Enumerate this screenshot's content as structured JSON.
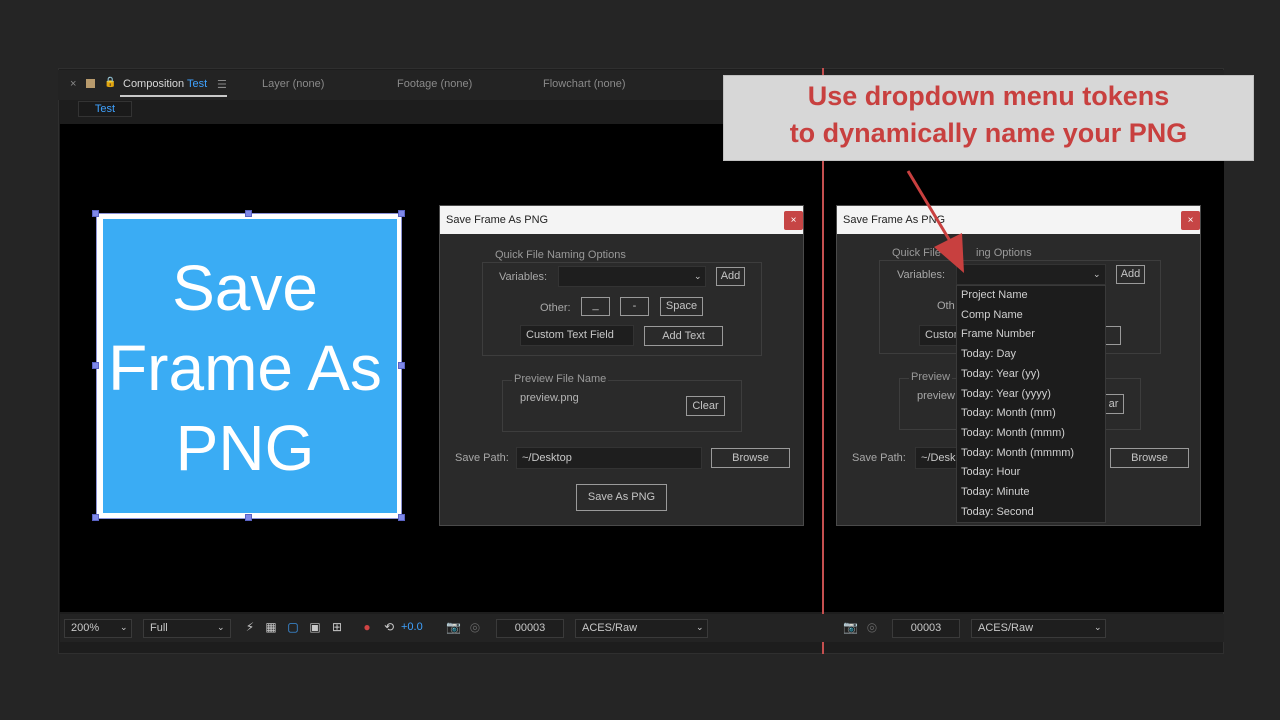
{
  "panel": {
    "tabs": {
      "composition_label": "Composition",
      "composition_name": "Test",
      "layer": "Layer",
      "layer_value": "(none)",
      "footage": "Footage",
      "footage_value": "(none)",
      "flowchart": "Flowchart",
      "flowchart_value": "(none)",
      "close_glyph": "×",
      "menu_glyph": "☰",
      "subtab": "Test"
    }
  },
  "canvas": {
    "text_line1": "Save",
    "text_line2": "Frame As",
    "text_line3": "PNG",
    "bg_color": "#3aacf4"
  },
  "callout": {
    "line1": "Use dropdown menu tokens",
    "line2": "to dynamically name your PNG",
    "text_color": "#c8403f"
  },
  "dialog_left": {
    "title": "Save Frame As PNG",
    "close": "×",
    "quick_group": "Quick File Naming Options",
    "variables_label": "Variables:",
    "variables_value": "",
    "add_button": "Add",
    "other_label": "Other:",
    "underscore_button": "_",
    "dash_button": "-",
    "space_button": "Space",
    "custom_text_value": "Custom Text Field",
    "add_text_button": "Add Text",
    "preview_group": "Preview File Name",
    "preview_value": "preview.png",
    "clear_button": "Clear",
    "save_path_label": "Save Path:",
    "save_path_value": "~/Desktop",
    "browse_button": "Browse",
    "save_button": "Save As PNG"
  },
  "dialog_right": {
    "title": "Save Frame As PNG",
    "close": "×",
    "quick_group_left": "Quick File",
    "quick_group_right": "ing Options",
    "variables_label": "Variables:",
    "add_button": "Add",
    "other_partial": "Oth",
    "custom_partial": "Custon",
    "preview_partial_1": "Preview",
    "preview_partial_2": "preview",
    "clear_partial": "ar",
    "save_path_label": "Save Path:",
    "save_path_partial": "~/Desk",
    "browse_button": "Browse"
  },
  "dropdown": {
    "items": [
      "Project Name",
      "Comp Name",
      "Frame Number",
      "Today: Day",
      "Today: Year (yy)",
      "Today: Year (yyyy)",
      "Today: Month (mm)",
      "Today: Month (mmm)",
      "Today: Month (mmmm)",
      "Today: Hour",
      "Today: Minute",
      "Today: Second"
    ]
  },
  "toolbar": {
    "zoom": "200%",
    "resolution": "Full",
    "exposure": "+0.0",
    "frame_left": "00003",
    "colorspace_left": "ACES/Raw",
    "frame_right": "00003",
    "colorspace_right": "ACES/Raw"
  }
}
